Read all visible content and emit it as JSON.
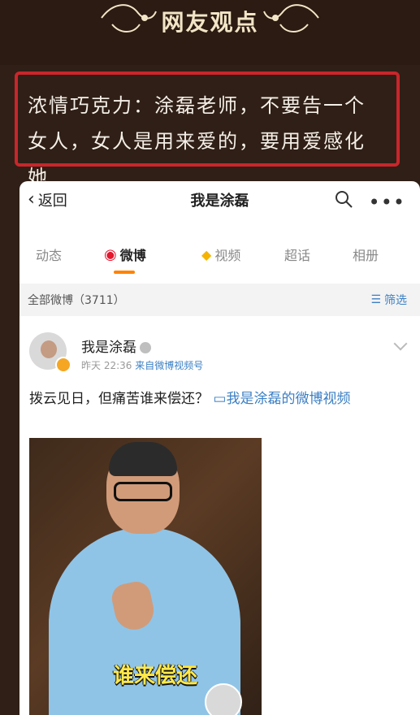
{
  "header": {
    "title": "网友观点"
  },
  "comment": {
    "text": "浓情巧克力：涂磊老师，不要告一个女人，女人是用来爱的，要用爱感化她"
  },
  "weibo": {
    "back_label": "返回",
    "title": "我是涂磊",
    "tabs": [
      "动态",
      "微博",
      "视频",
      "超话",
      "相册"
    ],
    "filter_count": "全部微博（3711）",
    "filter_label": "筛选",
    "post": {
      "author": "我是涂磊",
      "time": "昨天 22:36",
      "source": "来自微博视频号",
      "text": "拨云见日，但痛苦谁来偿还？",
      "video_link": "我是涂磊的微博视频",
      "video_caption": "谁来偿还"
    }
  }
}
